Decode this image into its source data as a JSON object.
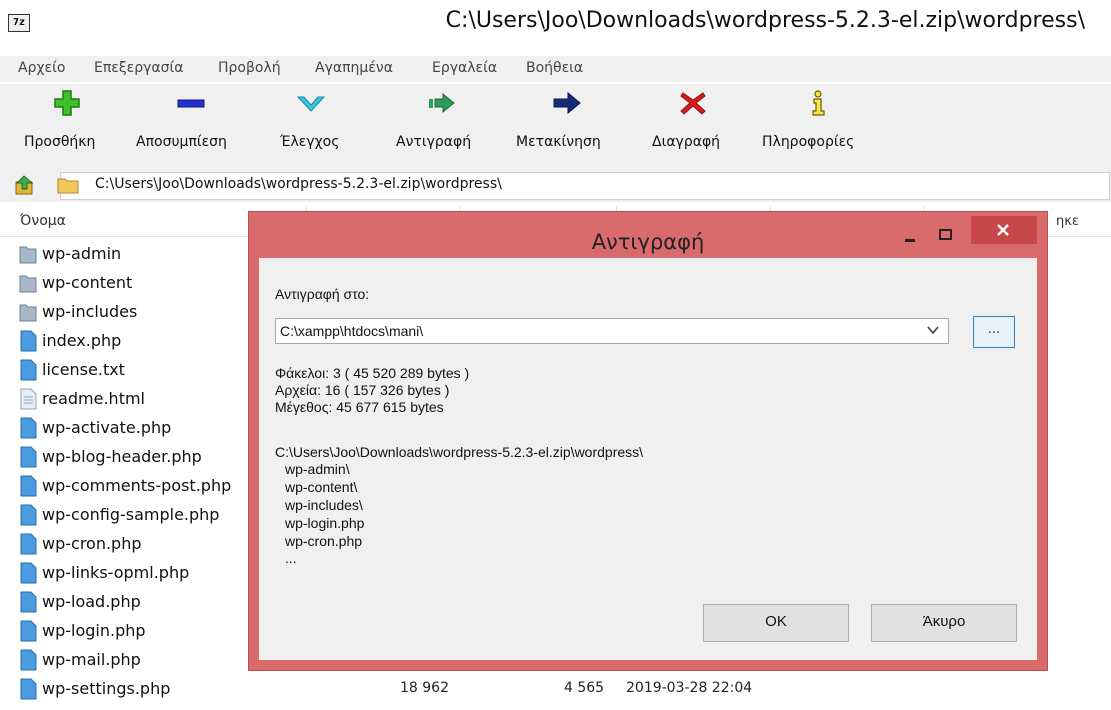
{
  "window": {
    "icon_text": "7z",
    "title": "C:\\Users\\Joo\\Downloads\\wordpress-5.2.3-el.zip\\wordpress\\"
  },
  "menu": [
    "Αρχείο",
    "Επεξεργασία",
    "Προβολή",
    "Αγαπημένα",
    "Εργαλεία",
    "Βοήθεια"
  ],
  "toolbar": [
    {
      "label": "Προσθήκη",
      "icon": "add-icon"
    },
    {
      "label": "Αποσυμπίεση",
      "icon": "extract-icon"
    },
    {
      "label": "Έλεγχος",
      "icon": "test-icon"
    },
    {
      "label": "Αντιγραφή",
      "icon": "copy-icon"
    },
    {
      "label": "Μετακίνηση",
      "icon": "move-icon"
    },
    {
      "label": "Διαγραφή",
      "icon": "delete-icon"
    },
    {
      "label": "Πληροφορίες",
      "icon": "info-icon"
    }
  ],
  "address": {
    "path": "C:\\Users\\Joo\\Downloads\\wordpress-5.2.3-el.zip\\wordpress\\"
  },
  "columns": {
    "name": "Όνομα",
    "last_partial": "ηκε"
  },
  "files": [
    {
      "name": "wp-admin",
      "type": "folder"
    },
    {
      "name": "wp-content",
      "type": "folder"
    },
    {
      "name": "wp-includes",
      "type": "folder"
    },
    {
      "name": "index.php",
      "type": "file"
    },
    {
      "name": "license.txt",
      "type": "file"
    },
    {
      "name": "readme.html",
      "type": "html"
    },
    {
      "name": "wp-activate.php",
      "type": "file"
    },
    {
      "name": "wp-blog-header.php",
      "type": "file"
    },
    {
      "name": "wp-comments-post.php",
      "type": "file"
    },
    {
      "name": "wp-config-sample.php",
      "type": "file"
    },
    {
      "name": "wp-cron.php",
      "type": "file"
    },
    {
      "name": "wp-links-opml.php",
      "type": "file"
    },
    {
      "name": "wp-load.php",
      "type": "file"
    },
    {
      "name": "wp-login.php",
      "type": "file"
    },
    {
      "name": "wp-mail.php",
      "type": "file"
    },
    {
      "name": "wp-settings.php",
      "type": "file",
      "size": "18 962",
      "packed": "4 565",
      "modified": "2019-03-28 22:04"
    }
  ],
  "dialog": {
    "title": "Αντιγραφή",
    "copy_to_label": "Αντιγραφή στο:",
    "destination": "C:\\xampp\\htdocs\\mani\\",
    "browse_label": "...",
    "folders_line": "Φάκελοι: 3    ( 45 520 289 bytes )",
    "files_line": "Αρχεία: 16    ( 157 326 bytes )",
    "size_line": "Μέγεθος: 45 677 615 bytes",
    "source_path": "C:\\Users\\Joo\\Downloads\\wordpress-5.2.3-el.zip\\wordpress\\",
    "items": [
      "wp-admin\\",
      "wp-content\\",
      "wp-includes\\",
      "wp-login.php",
      "wp-cron.php",
      "..."
    ],
    "ok_label": "OK",
    "cancel_label": "Άκυρο",
    "frame_color": "#da6b6d",
    "close_color": "#c7474a"
  }
}
